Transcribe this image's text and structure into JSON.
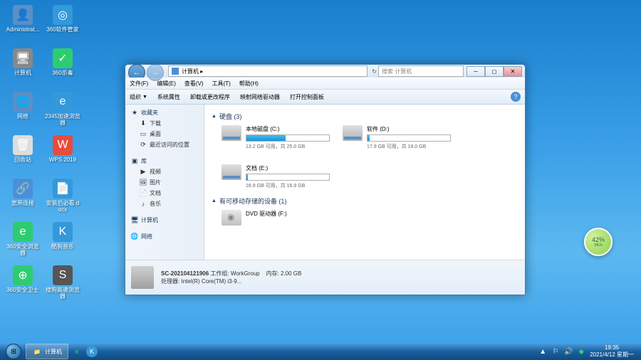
{
  "desktop_icons": [
    {
      "label": "Administrat...",
      "bg": "#5a8fc7",
      "glyph": "👤"
    },
    {
      "label": "计算机",
      "bg": "#888",
      "glyph": "🖥"
    },
    {
      "label": "网络",
      "bg": "#5a8fc7",
      "glyph": "🌐"
    },
    {
      "label": "回收站",
      "bg": "#ddd",
      "glyph": "🗑"
    },
    {
      "label": "宽带连接",
      "bg": "#4a90d9",
      "glyph": "🔗"
    },
    {
      "label": "360安全浏览器",
      "bg": "#2ecc71",
      "glyph": "e"
    },
    {
      "label": "360安全卫士",
      "bg": "#2ecc71",
      "glyph": "⊕"
    },
    {
      "label": "360软件管家",
      "bg": "#3498db",
      "glyph": "◎"
    },
    {
      "label": "360杀毒",
      "bg": "#2ecc71",
      "glyph": "✓"
    },
    {
      "label": "2345加速浏览器",
      "bg": "#3498db",
      "glyph": "e"
    },
    {
      "label": "WPS 2019",
      "bg": "#e74c3c",
      "glyph": "W"
    },
    {
      "label": "安装后必看.docx",
      "bg": "#3498db",
      "glyph": "📄"
    },
    {
      "label": "酷狗音乐",
      "bg": "#3498db",
      "glyph": "K"
    },
    {
      "label": "搜狗高速浏览器",
      "bg": "#555",
      "glyph": "S"
    }
  ],
  "window": {
    "address": "计算机 ▸",
    "search_placeholder": "搜索 计算机",
    "menubar": [
      "文件(F)",
      "编辑(E)",
      "查看(V)",
      "工具(T)",
      "帮助(H)"
    ],
    "toolbar": [
      "组织",
      "系统属性",
      "卸载或更改程序",
      "映射网络驱动器",
      "打开控制面板"
    ],
    "sidebar": {
      "fav_header": "收藏夹",
      "fav_items": [
        "下载",
        "桌面",
        "最近访问的位置"
      ],
      "lib_header": "库",
      "lib_items": [
        "视频",
        "图片",
        "文档",
        "音乐"
      ],
      "computer": "计算机",
      "network": "网络"
    },
    "content": {
      "group1": "硬盘 (3)",
      "drives": [
        {
          "name": "本地磁盘 (C:)",
          "info": "13.2 GB 可用，共 25.0 GB",
          "fill": 47
        },
        {
          "name": "软件 (D:)",
          "info": "17.9 GB 可用，共 18.0 GB",
          "fill": 3
        },
        {
          "name": "文档 (E:)",
          "info": "16.9 GB 可用，共 16.9 GB",
          "fill": 2
        }
      ],
      "group2": "有可移动存储的设备 (1)",
      "removable": [
        {
          "name": "DVD 驱动器 (F:)"
        }
      ]
    },
    "details": {
      "name": "SC-202104121906",
      "workgroup_label": "工作组:",
      "workgroup": "WorkGroup",
      "mem_label": "内存:",
      "mem": "2.00 GB",
      "cpu_label": "处理器:",
      "cpu": "Intel(R) Core(TM) i3-9..."
    }
  },
  "taskbar": {
    "task": "计算机",
    "time": "19:35",
    "date": "2021/4/12 星期一"
  },
  "widget": {
    "pct": "42%",
    "speed": "0K/s"
  }
}
